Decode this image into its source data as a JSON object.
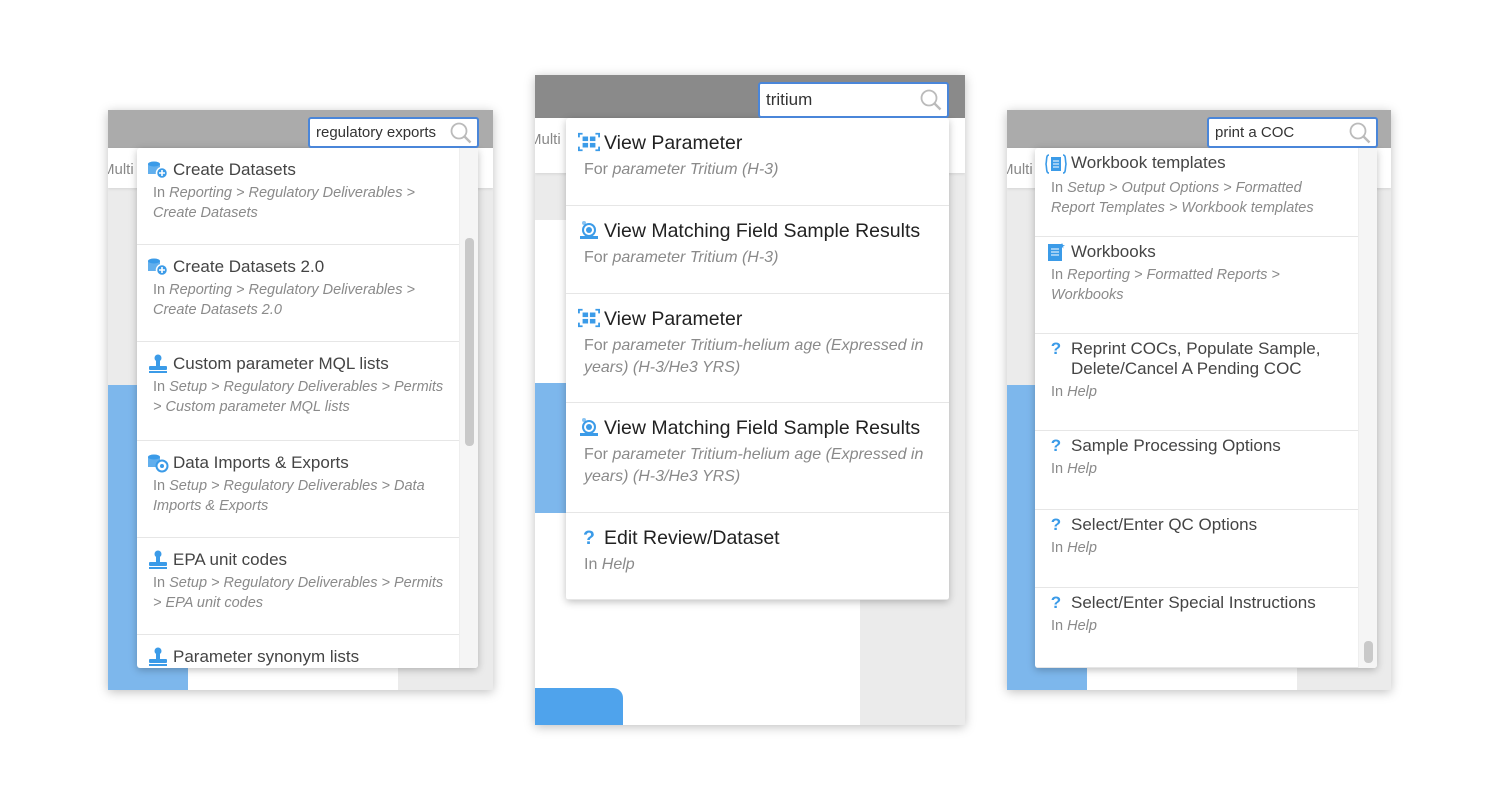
{
  "background_label": "Multi",
  "panels": [
    {
      "search_value": "regulatory exports",
      "items": [
        {
          "icon": "dataset-add-icon",
          "title": "Create Datasets",
          "prefix": "In",
          "path": "Reporting > Regulatory Deliverables > Create Datasets"
        },
        {
          "icon": "dataset-add-icon",
          "title": "Create Datasets 2.0",
          "prefix": "In",
          "path": "Reporting > Regulatory Deliverables > Create Datasets 2.0"
        },
        {
          "icon": "stamp-icon",
          "title": "Custom parameter MQL lists",
          "prefix": "In",
          "path": "Setup > Regulatory Deliverables > Permits > Custom parameter MQL lists"
        },
        {
          "icon": "dataset-gear-icon",
          "title": "Data Imports & Exports",
          "prefix": "In",
          "path": "Setup > Regulatory Deliverables > Data Imports & Exports"
        },
        {
          "icon": "stamp-icon",
          "title": "EPA unit codes",
          "prefix": "In",
          "path": "Setup > Regulatory Deliverables > Permits > EPA unit codes"
        },
        {
          "icon": "stamp-icon",
          "title": "Parameter synonym lists",
          "prefix": "",
          "path": ""
        }
      ]
    },
    {
      "search_value": "tritium",
      "items": [
        {
          "icon": "parameter-grid-icon",
          "title": "View Parameter",
          "prefix": "For",
          "path": "parameter Tritium (H-3)"
        },
        {
          "icon": "field-sample-icon",
          "title": "View Matching Field Sample Results",
          "prefix": "For",
          "path": "parameter Tritium (H-3)"
        },
        {
          "icon": "parameter-grid-icon",
          "title": "View Parameter",
          "prefix": "For",
          "path": "parameter Tritium-helium age (Expressed in years) (H-3/He3 YRS)"
        },
        {
          "icon": "field-sample-icon",
          "title": "View Matching Field Sample Results",
          "prefix": "For",
          "path": "parameter Tritium-helium age (Expressed in years) (H-3/He3 YRS)"
        },
        {
          "icon": "help-icon",
          "title": "Edit Review/Dataset",
          "prefix": "In",
          "path": "Help"
        }
      ]
    },
    {
      "search_value": "print a COC",
      "items": [
        {
          "icon": "workbook-template-icon",
          "title": "Workbook templates",
          "prefix": "In",
          "path": "Setup > Output Options > Formatted Report Templates > Workbook templates"
        },
        {
          "icon": "workbook-icon",
          "title": "Workbooks",
          "prefix": "In",
          "path": "Reporting > Formatted Reports > Workbooks"
        },
        {
          "icon": "help-icon",
          "title": "Reprint COCs, Populate Sample, Delete/Cancel A Pending COC",
          "prefix": "In",
          "path": "Help"
        },
        {
          "icon": "help-icon",
          "title": "Sample Processing Options",
          "prefix": "In",
          "path": "Help"
        },
        {
          "icon": "help-icon",
          "title": "Select/Enter QC Options",
          "prefix": "In",
          "path": "Help"
        },
        {
          "icon": "help-icon",
          "title": "Select/Enter Special Instructions",
          "prefix": "In",
          "path": "Help"
        }
      ]
    }
  ],
  "colors": {
    "accent": "#3b9be8",
    "search_border": "#4a86d9",
    "header": "#ababab"
  }
}
